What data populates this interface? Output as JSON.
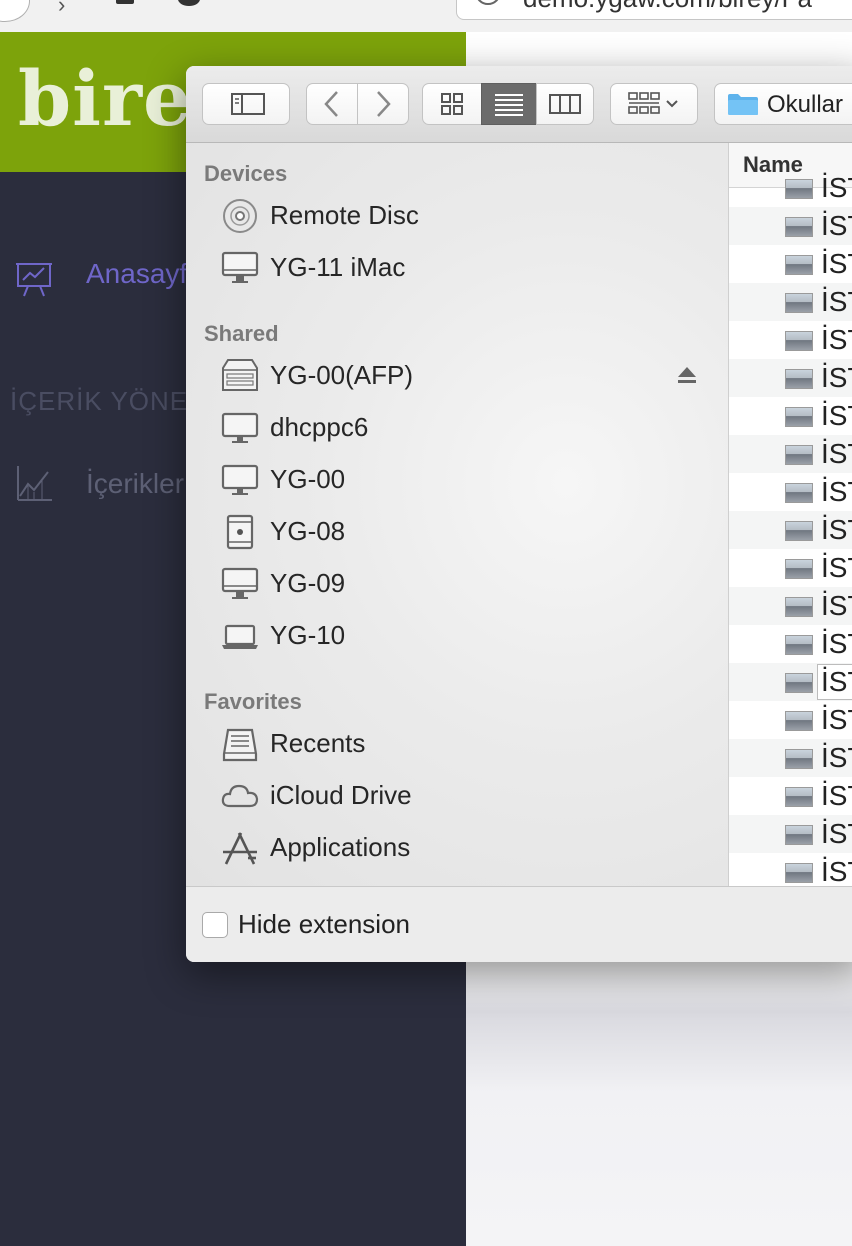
{
  "browser": {
    "url": "demo.ygaw.com/birey/Fa"
  },
  "admin": {
    "brand": "birey",
    "nav_home": "Anasayfa",
    "section_title": "İÇERİK YÖNETİMİ",
    "nav_content": "İçerikler",
    "accent_color": "#7da30b",
    "sidebar_color": "#2b2d3d"
  },
  "dialog": {
    "location": "Okullar",
    "column_header": "Name",
    "sections": {
      "devices": "Devices",
      "shared": "Shared",
      "favorites": "Favorites"
    },
    "devices": [
      {
        "label": "Remote Disc",
        "icon": "disc-icon"
      },
      {
        "label": "YG-11 iMac",
        "icon": "imac-icon"
      }
    ],
    "shared": [
      {
        "label": "YG-00(AFP)",
        "icon": "server-icon"
      },
      {
        "label": "dhcppc6",
        "icon": "monitor-icon"
      },
      {
        "label": "YG-00",
        "icon": "monitor-icon"
      },
      {
        "label": "YG-08",
        "icon": "mac-pro-icon"
      },
      {
        "label": "YG-09",
        "icon": "imac-icon"
      },
      {
        "label": "YG-10",
        "icon": "laptop-icon"
      }
    ],
    "favorites": [
      {
        "label": "Recents",
        "icon": "recents-icon"
      },
      {
        "label": "iCloud Drive",
        "icon": "cloud-icon"
      },
      {
        "label": "Applications",
        "icon": "applications-icon"
      }
    ],
    "files": [
      "İST",
      "İST",
      "İST",
      "İST",
      "İST",
      "İST",
      "İST",
      "İST",
      "İST",
      "İST",
      "İST",
      "İST",
      "İST",
      "İST",
      "İST",
      "İST",
      "İST",
      "İST",
      "İST"
    ],
    "hide_extension": "Hide extension"
  }
}
